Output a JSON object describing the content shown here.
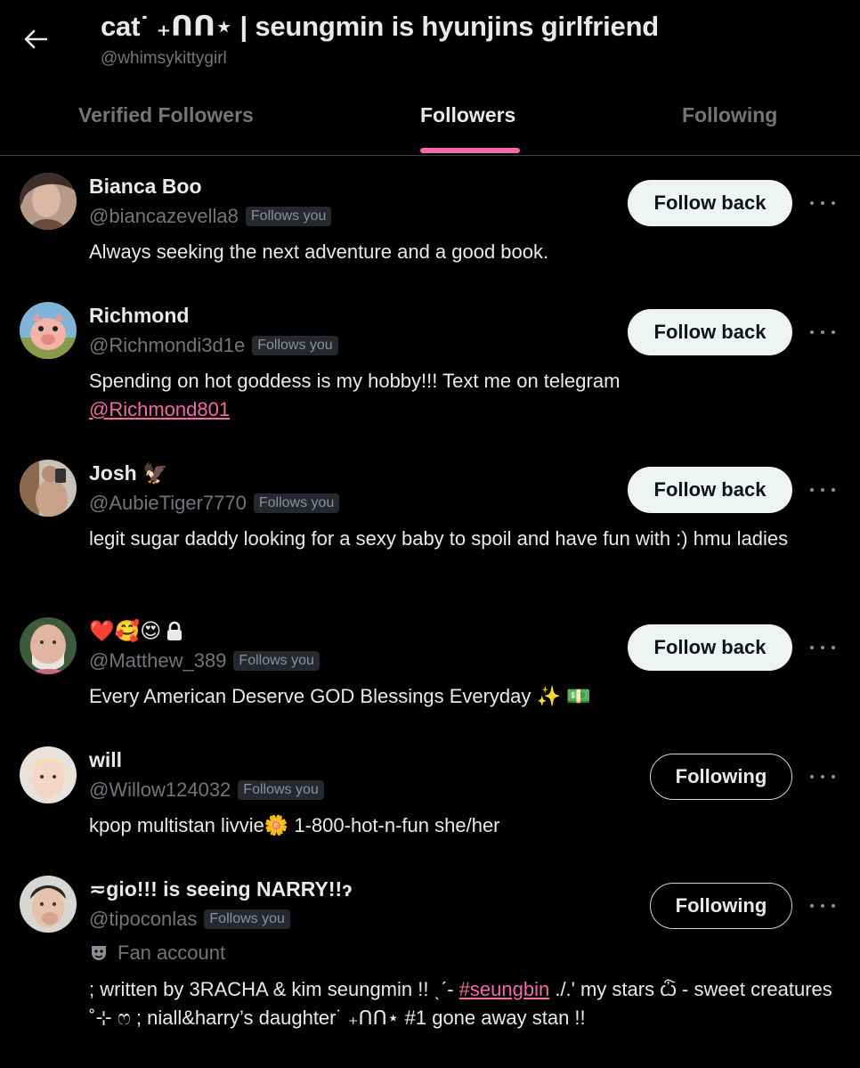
{
  "header": {
    "title": "cat˙ ₊ᑎᑎ⋆ | seungmin is hyunjins girlfriend",
    "handle": "@whimsykittygirl"
  },
  "tabs": [
    {
      "label": "Verified Followers",
      "active": false
    },
    {
      "label": "Followers",
      "active": true
    },
    {
      "label": "Following",
      "active": false
    }
  ],
  "colors": {
    "accent": "#f26aa8",
    "background": "#000000",
    "muted": "#71767b"
  },
  "followers": [
    {
      "name": "Bianca Boo",
      "handle": "@biancazevella8",
      "badge": "Follows you",
      "bio": "Always seeking the next adventure and a good book.",
      "button": "Follow back"
    },
    {
      "name": "Richmond",
      "handle": "@Richmondi3d1e",
      "badge": "Follows you",
      "bio": "Spending on hot goddess is my hobby!!! Text me on telegram",
      "bio_link": "@Richmond801",
      "button": "Follow back"
    },
    {
      "name": "Josh 🦅",
      "handle": "@AubieTiger7770",
      "badge": "Follows you",
      "bio": "legit sugar daddy looking for a sexy baby to spoil and have fun with :) hmu ladies",
      "button": "Follow back"
    },
    {
      "name": "❤️🥰😍",
      "handle": "@Matthew_389",
      "badge": "Follows you",
      "bio": "Every American Deserve GOD Blessings Everyday ✨ 💵",
      "button": "Follow back"
    },
    {
      "name": "will",
      "handle": "@Willow124032",
      "badge": "Follows you",
      "bio": "kpop multistan livvie🌼 1-800-hot-n-fun she/her",
      "button": "Following"
    },
    {
      "name": "≂gio!!! is seeing NARRY!!ɂ",
      "handle": "@tipoconlas",
      "badge": "Follows you",
      "label": "Fan account",
      "bio_before": "; written by 3RACHA & kim seungmin !! ˎˊ- ",
      "bio_link": "#seungbin",
      "bio_after": " ./.' my stars ѽ - sweet creatures ˚⊹ ෆ ; niall&harry’s daughter˙ ₊ᑎᑎ⋆ #1 gone away stan !!",
      "button": "Following"
    }
  ]
}
